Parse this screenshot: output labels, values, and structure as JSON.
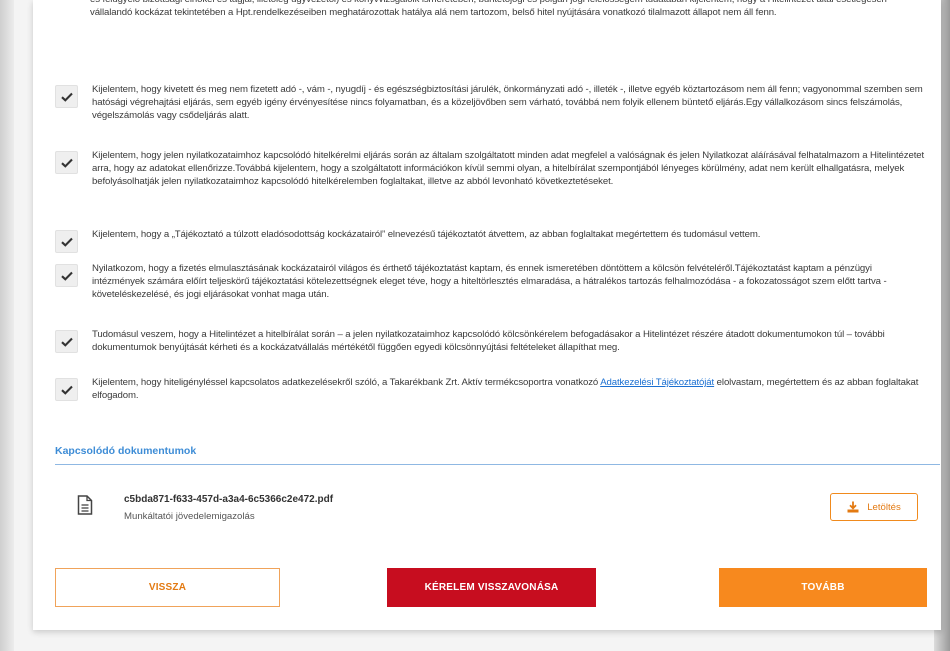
{
  "declarations": {
    "top_partial": "és felügyelő bizottsági elnökei és tagjai, illetőleg ügyvezetői) és könyvvizsgálóik ismeretében, büntetőjogi és polgári jogi felelősségem tudatában kijelentem, hogy a Hitelintézet által esetlegesen vállalandó kockázat tekintetében a Hpt.rendelkezéseiben meghatározottak hatálya alá nem tartozom, belső hitel nyújtására vonatkozó tilalmazott állapot nem áll fenn.",
    "items": [
      {
        "text": "Kijelentem, hogy kivetett és meg nem fizetett adó -, vám -, nyugdíj - és egészségbiztosítási járulék, önkormányzati adó -, illeték -, illetve egyéb köztartozásom nem áll fenn; vagyonommal szemben sem hatósági végrehajtási eljárás, sem egyéb igény érvényesítése nincs folyamatban, és a közeljövőben sem várható, továbbá nem folyik ellenem büntető eljárás.Egy vállalkozásom sincs felszámolás, végelszámolás vagy csődeljárás alatt.",
        "checked": true
      },
      {
        "text": "Kijelentem, hogy jelen nyilatkozataimhoz kapcsolódó hitelkérelmi eljárás során az általam szolgáltatott minden adat megfelel a valóságnak és jelen Nyilatkozat aláírásával felhatalmazom a Hitelintézetet arra, hogy az adatokat ellenőrizze.Továbbá kijelentem, hogy a szolgáltatott információkon kívül semmi olyan, a hitelbírálat szempontjából lényeges körülmény, adat nem került elhallgatásra, melyek befolyásolhatják jelen nyilatkozataimhoz kapcsolódó hitelkérelemben foglaltakat, illetve az abból levonható következtetéseket.",
        "checked": true
      },
      {
        "text": "Kijelentem, hogy a „Tájékoztató a túlzott eladósodottság kockázatairól” elnevezésű tájékoztatót átvettem, az abban foglaltakat megértettem és tudomásul vettem.",
        "checked": true
      },
      {
        "text": "Nyilatkozom, hogy a fizetés elmulasztásának kockázatairól világos és érthető tájékoztatást kaptam, és ennek ismeretében döntöttem a kölcsön felvételéről.Tájékoztatást kaptam a pénzügyi intézmények számára előírt teljeskörű tájékoztatási kötelezettségnek eleget téve, hogy a hiteltörlesztés elmaradása, a hátralékos tartozás felhalmozódása - a fokozatosságot szem előtt tartva - követeléskezelésé, és jogi eljárásokat vonhat maga után.",
        "checked": true
      },
      {
        "text": "Tudomásul veszem, hogy a Hitelintézet a hitelbírálat során – a jelen nyilatkozataimhoz kapcsolódó kölcsönkérelem befogadásakor a Hitelintézet részére átadott dokumentumokon túl – további dokumentumok benyújtását kérheti és a kockázatvállalás mértékétől függően egyedi kölcsönnyújtási feltételeket állapíthat meg.",
        "checked": true
      }
    ],
    "last": {
      "text_before": "Kijelentem, hogy hiteligényléssel kapcsolatos adatkezelésekről szóló, a Takarékbank Zrt. Aktív termékcsoportra vonatkozó ",
      "link": "Adatkezelési Tájékoztatóját",
      "text_after": " elolvastam, megértettem és az abban foglaltakat elfogadom.",
      "checked": true
    }
  },
  "related_docs": {
    "title": "Kapcsolódó dokumentumok",
    "file_name": "c5bda871-f633-457d-a3a4-6c5366c2e472.pdf",
    "file_type": "Munkáltatói jövedelemigazolás",
    "download_label": "Letöltés"
  },
  "buttons": {
    "back": "VISSZA",
    "cancel": "KÉRELEM VISSZAVONÁSA",
    "next": "TOVÁBB"
  },
  "colors": {
    "accent_orange": "#f7891e",
    "danger_red": "#c70d1f",
    "link_blue": "#1a6fd1",
    "section_blue": "#3d8cd6"
  },
  "icons": {
    "checkbox": "checkmark-icon",
    "document": "document-icon",
    "download": "download-icon"
  }
}
